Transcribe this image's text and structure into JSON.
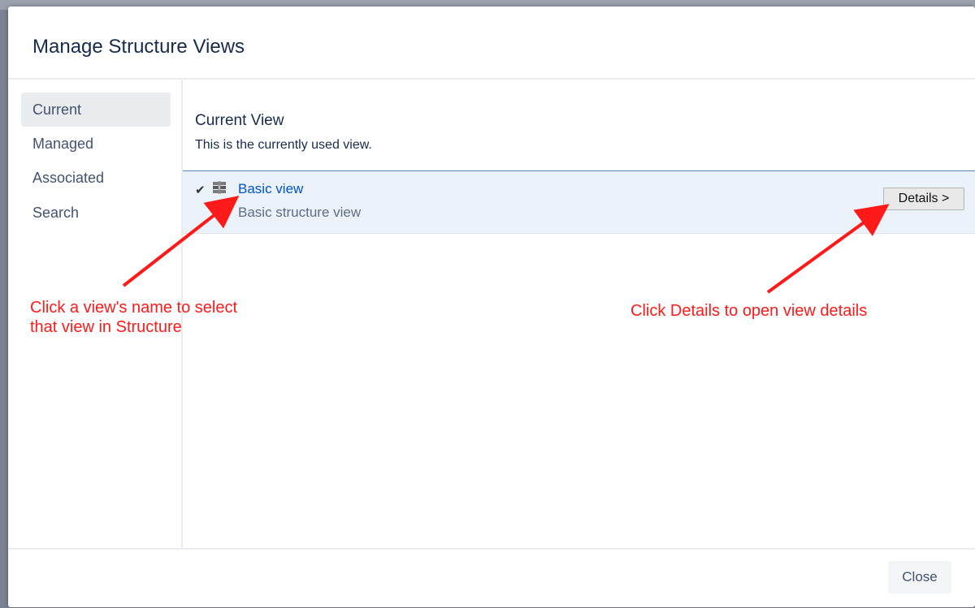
{
  "dialog": {
    "title": "Manage Structure Views"
  },
  "nav": {
    "items": [
      {
        "label": "Current",
        "active": true
      },
      {
        "label": "Managed",
        "active": false
      },
      {
        "label": "Associated",
        "active": false
      },
      {
        "label": "Search",
        "active": false
      }
    ]
  },
  "current_view": {
    "title": "Current View",
    "description": "This is the currently used view.",
    "view": {
      "name": "Basic view",
      "description": "Basic structure view",
      "details_label": "Details >"
    }
  },
  "footer": {
    "close_label": "Close"
  },
  "annotations": {
    "select_hint": "Click a view's name to select\nthat view in Structure",
    "details_hint": "Click Details to open view details"
  },
  "colors": {
    "annotation": "#ff1a1a",
    "link": "#0052cc",
    "selected_row": "#ebf2fa"
  }
}
